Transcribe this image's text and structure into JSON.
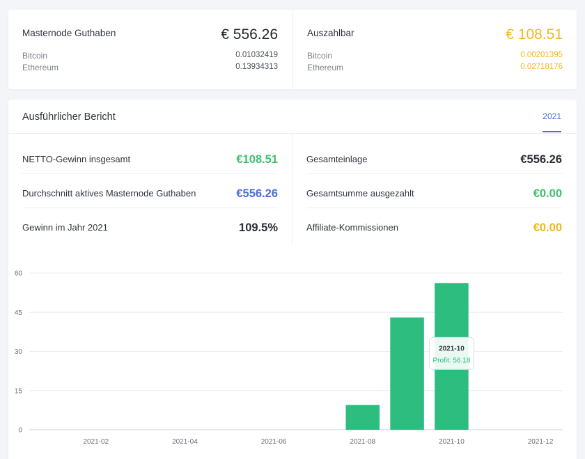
{
  "summary": {
    "left": {
      "label": "Masternode Guthaben",
      "amount": "€ 556.26",
      "rows": [
        {
          "name": "Bitcoin",
          "value": "0.01032419"
        },
        {
          "name": "Ethereum",
          "value": "0.13934313"
        }
      ]
    },
    "right": {
      "label": "Auszahlbar",
      "amount": "€ 108.51",
      "rows": [
        {
          "name": "Bitcoin",
          "value": "0.00201395"
        },
        {
          "name": "Ethereum",
          "value": "0.02718176"
        }
      ]
    }
  },
  "report": {
    "title": "Ausführlicher Bericht",
    "year_tab": "2021",
    "left_stats": [
      {
        "label": "NETTO-Gewinn insgesamt",
        "value": "€108.51",
        "color": "#3fc06c"
      },
      {
        "label": "Durchschnitt aktives Masternode Guthaben",
        "value": "€556.26",
        "color": "#4d6fd0"
      },
      {
        "label": "Gewinn im Jahr 2021",
        "value": "109.5%",
        "color": "#2a2e35"
      }
    ],
    "right_stats": [
      {
        "label": "Gesamteinlage",
        "value": "€556.26",
        "color": "#2a2e35"
      },
      {
        "label": "Gesamtsumme ausgezahlt",
        "value": "€0.00",
        "color": "#3fc06c"
      },
      {
        "label": "Affiliate-Kommissionen",
        "value": "€0.00",
        "color": "#f2b71f"
      }
    ]
  },
  "chart_data": {
    "type": "bar",
    "categories": [
      "2021-01",
      "2021-02",
      "2021-03",
      "2021-04",
      "2021-05",
      "2021-06",
      "2021-07",
      "2021-08",
      "2021-09",
      "2021-10",
      "2021-11",
      "2021-12"
    ],
    "series": [
      {
        "values": [
          0,
          0,
          0,
          0,
          0,
          0,
          0,
          9.5,
          43,
          56.18,
          0,
          0
        ]
      }
    ],
    "x_tick_labels": [
      "2021-02",
      "2021-04",
      "2021-06",
      "2021-08",
      "2021-10",
      "2021-12"
    ],
    "y_ticks": [
      0,
      15,
      30,
      45,
      60
    ],
    "ylim": [
      0,
      60
    ],
    "grid": true,
    "bar_color": "#2dbd7f",
    "tooltip": {
      "title": "2021-10",
      "label": "Profit: 56.18"
    }
  }
}
